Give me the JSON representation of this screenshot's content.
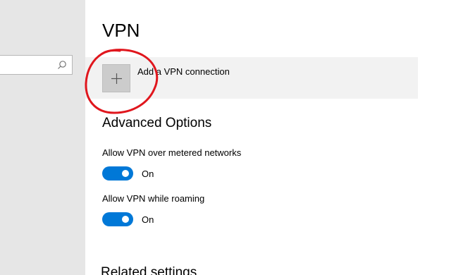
{
  "sidebar": {
    "search": {
      "placeholder": "",
      "value": "",
      "icon": "search-icon"
    }
  },
  "main": {
    "title": "VPN",
    "add_vpn": {
      "label": "Add a VPN connection",
      "icon": "plus-icon"
    },
    "advanced_options": {
      "heading": "Advanced Options",
      "settings": [
        {
          "label": "Allow VPN over metered networks",
          "state": "On",
          "enabled": true
        },
        {
          "label": "Allow VPN while roaming",
          "state": "On",
          "enabled": true
        }
      ]
    },
    "related_settings": {
      "heading": "Related settings"
    }
  },
  "colors": {
    "accent": "#0078d7",
    "sidebar_background": "#e6e6e6",
    "row_background": "#f2f2f2",
    "tile_background": "#cccccc",
    "annotation": "#e0161d"
  }
}
